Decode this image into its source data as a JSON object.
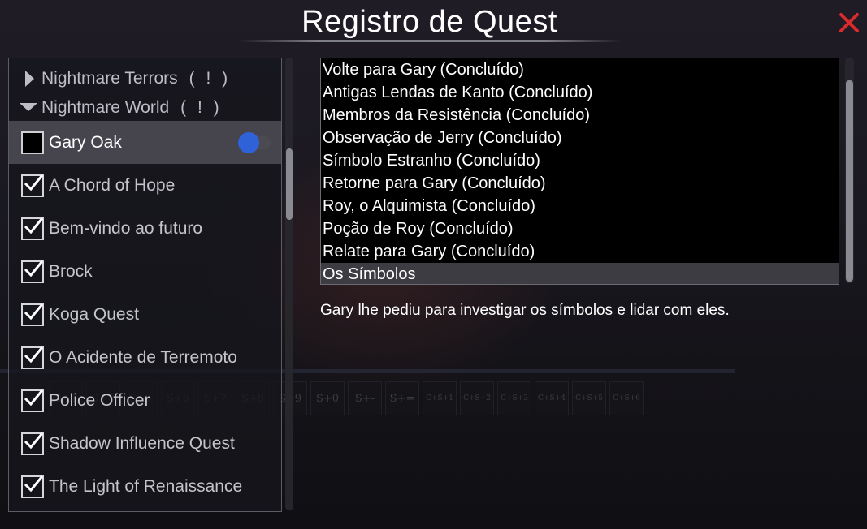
{
  "window": {
    "title": "Registro de Quest",
    "close_icon": "close-icon",
    "accent_close": "#d92b2b"
  },
  "groups": [
    {
      "label": "Nightmare Terrors",
      "flag": "( ! )",
      "expanded": false,
      "icon": "triangle-right-icon"
    },
    {
      "label": "Nightmare World",
      "flag": "( ! )",
      "expanded": true,
      "icon": "triangle-down-icon"
    }
  ],
  "quests": [
    {
      "label": "Gary Oak",
      "completed": false,
      "selected": true,
      "tracking_toggle": "on"
    },
    {
      "label": "A Chord of Hope",
      "completed": true
    },
    {
      "label": "Bem-vindo ao futuro",
      "completed": true
    },
    {
      "label": "Brock",
      "completed": true
    },
    {
      "label": "Koga Quest",
      "completed": true
    },
    {
      "label": "O Acidente de Terremoto",
      "completed": true
    },
    {
      "label": "Police Officer",
      "completed": true
    },
    {
      "label": "Shadow Influence Quest",
      "completed": true
    },
    {
      "label": "The Light of Renaissance",
      "completed": true
    }
  ],
  "steps": [
    "Volte para Gary (Concluído)",
    "Antigas Lendas de Kanto (Concluído)",
    "Membros da Resistência (Concluído)",
    "Observação de Jerry (Concluído)",
    "Símbolo Estranho (Concluído)",
    "Retorne para Gary (Concluído)",
    "Roy, o Alquimista (Concluído)",
    "Poção de Roy (Concluído)",
    "Relate para Gary (Concluído)",
    "Os Símbolos"
  ],
  "current_step_index": 9,
  "description": "Gary lhe pediu para investigar os símbolos e lidar com eles.",
  "background_hotbar": [
    "S+1",
    "S+4",
    "S+5",
    "S+6",
    "S+7",
    "S+8",
    "S+9",
    "S+0",
    "S+-",
    "S+=",
    "C+S+1",
    "C+S+2",
    "C+S+3",
    "C+S+4",
    "C+S+5",
    "C+S+6"
  ],
  "colors": {
    "toggle_knob": "#2f62d8",
    "selected_row": "#5e5e66",
    "current_step": "#3c3c42"
  }
}
